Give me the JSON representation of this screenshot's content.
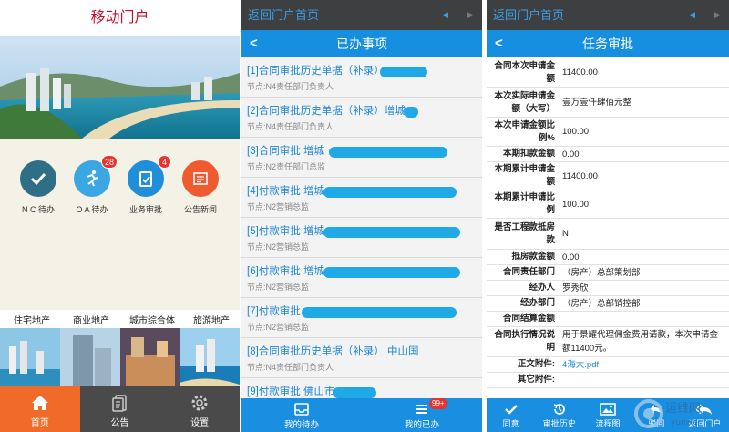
{
  "portal": {
    "title": "移动门户",
    "icons": [
      {
        "label": "N C 待办",
        "icon": "check-icon",
        "color": "#2f6f86",
        "badge": ""
      },
      {
        "label": "O A 待办",
        "icon": "runner-icon",
        "color": "#3aa7e3",
        "badge": "28"
      },
      {
        "label": "业务审批",
        "icon": "clipboard-check-icon",
        "color": "#1e8fd8",
        "badge": "4"
      },
      {
        "label": "公告新闻",
        "icon": "newspaper-icon",
        "color": "#ef5a2f",
        "badge": ""
      }
    ],
    "categories": [
      "住宅地产",
      "商业地产",
      "城市综合体",
      "旅游地产"
    ],
    "tabs": [
      {
        "label": "首页",
        "icon": "home-icon",
        "active": true
      },
      {
        "label": "公告",
        "icon": "document-icon",
        "active": false
      },
      {
        "label": "设置",
        "icon": "gear-icon",
        "active": false
      }
    ]
  },
  "done": {
    "status_back": "返回门户首页",
    "nav_title": "已办事项",
    "items": [
      {
        "title": "[1]合同审批历史单据（补录）",
        "node": "节点:N4责任部门负责人"
      },
      {
        "title": "[2]合同审批历史单据（补录）增城",
        "node": "节点:N4责任部门负责人"
      },
      {
        "title": "[3]合同审批  增城",
        "node": "节点:N2责任部门总监"
      },
      {
        "title": "[4]付款审批  增城",
        "node": "节点:N2营销总监"
      },
      {
        "title": "[5]付款审批  增城",
        "node": "节点:N2营销总监"
      },
      {
        "title": "[6]付款审批  增城",
        "node": "节点:N2营销总监"
      },
      {
        "title": "[7]付款审批",
        "node": "节点:N2营销总监"
      },
      {
        "title": "[8]合同审批历史单据（补录） 中山国",
        "node": "节点:N4责任部门负责人"
      },
      {
        "title": "[9]付款审批  佛山市",
        "node": ""
      }
    ],
    "tabs": [
      {
        "label": "我的待办",
        "icon": "inbox-icon",
        "badge": ""
      },
      {
        "label": "我的已办",
        "icon": "list-icon",
        "badge": "99+"
      }
    ]
  },
  "review": {
    "status_back": "返回门户首页",
    "nav_title": "任务审批",
    "rows": [
      {
        "label": "合同本次申请金额",
        "value": "11400.00"
      },
      {
        "label": "本次实际申请金额（大写）",
        "value": "壹万壹仟肆佰元整"
      },
      {
        "label": "本次申请金额比例%",
        "value": "100.00"
      },
      {
        "label": "本期扣款金额",
        "value": "0.00"
      },
      {
        "label": "本期累计申请金额",
        "value": "11400.00"
      },
      {
        "label": "本期累计申请比例",
        "value": "100.00"
      },
      {
        "label": "是否工程款抵房款",
        "value": "N"
      },
      {
        "label": "抵房款金额",
        "value": "0.00"
      },
      {
        "label": "合同责任部门",
        "value": "（房产）总部策划部"
      },
      {
        "label": "经办人",
        "value": "罗秀欣"
      },
      {
        "label": "经办部门",
        "value": "（房产）总部销控部"
      },
      {
        "label": "合同结算金额",
        "value": ""
      },
      {
        "label": "合同执行情况说明",
        "value": "用于景耀代理佣金费用请款，本次申请金额11400元。"
      },
      {
        "label": "正文附件:",
        "value": "4海大.pdf"
      },
      {
        "label": "其它附件:",
        "value": ""
      }
    ],
    "tabs": [
      {
        "label": "同意",
        "icon": "check-icon"
      },
      {
        "label": "审批历史",
        "icon": "history-icon"
      },
      {
        "label": "流程图",
        "icon": "image-icon"
      },
      {
        "label": "驳回",
        "icon": "reply-icon"
      },
      {
        "label": "返回门户",
        "icon": "reply-all-icon"
      }
    ]
  },
  "watermark": {
    "text": "运维网",
    "sub": "yunwei"
  }
}
